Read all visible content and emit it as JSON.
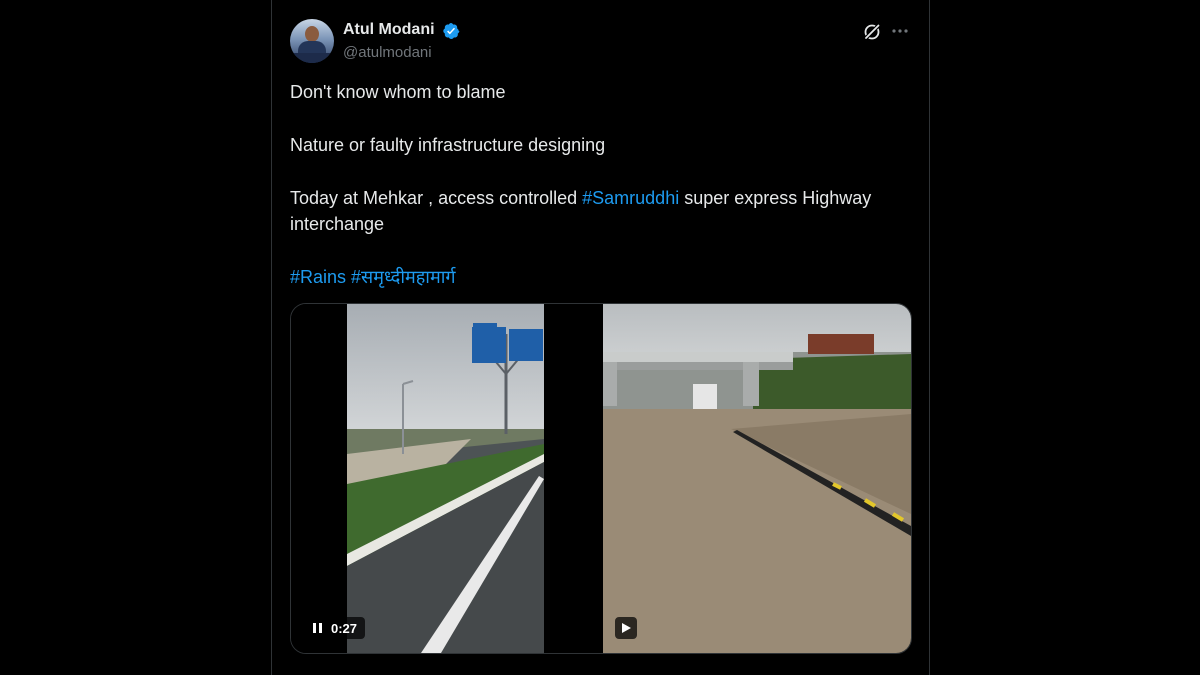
{
  "tweet": {
    "author_name": "Atul Modani",
    "author_handle": "@atulmodani",
    "line1": "Don't know whom to blame",
    "line2": "Nature or faulty infrastructure designing",
    "line3_prefix": "Today at Mehkar , access controlled ",
    "line3_hashtag": "#Samruddhi",
    "line3_suffix": " super express Highway",
    "line4": "interchange",
    "hashtag_rains": "#Rains",
    "hashtag_marathi": "#समृध्दीमहामार्ग"
  },
  "media": {
    "video1_time": "0:27",
    "video1_state": "playing",
    "video2_state": "paused"
  },
  "icons": {
    "verified": "verified-badge-icon",
    "grok": "grok-icon",
    "more": "more-options-icon",
    "pause": "pause-icon",
    "play": "play-icon"
  },
  "colors": {
    "background": "#000000",
    "text": "#e7e9ea",
    "secondary_text": "#71767b",
    "link": "#1d9bf0",
    "border": "#2f3336"
  }
}
